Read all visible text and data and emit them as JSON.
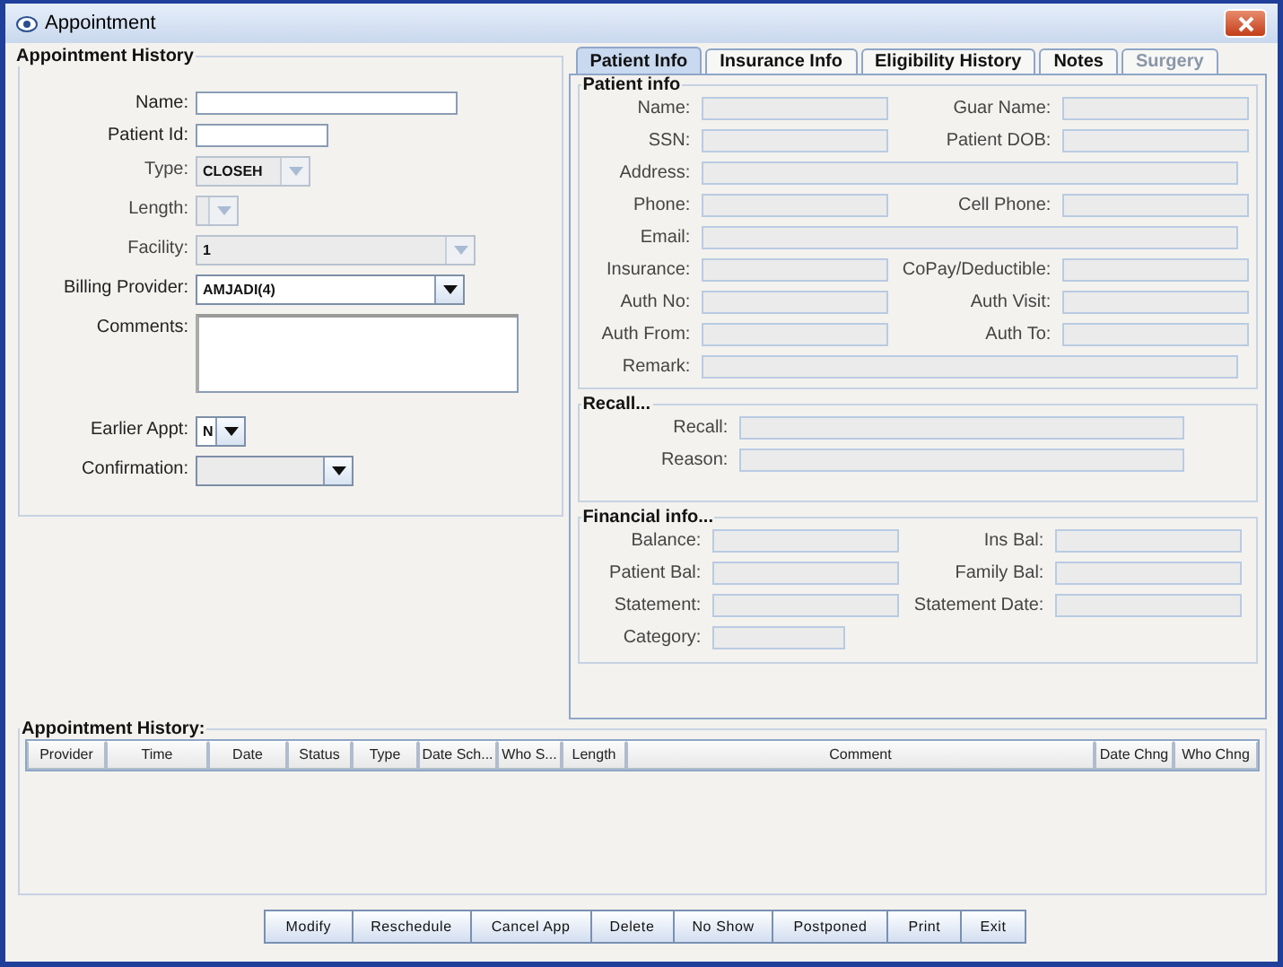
{
  "window": {
    "title": "Appointment"
  },
  "appointment_form": {
    "title": "Appointment History",
    "fields": [
      {
        "kind": "text",
        "label": "Name:"
      },
      {
        "kind": "text",
        "label": "Patient Id:"
      },
      {
        "kind": "combo",
        "label": "Type:",
        "value": "CLOSEH",
        "disabled": true
      },
      {
        "kind": "combo",
        "label": "Length:",
        "disabled": true
      },
      {
        "kind": "combo",
        "label": "Facility:",
        "value": "1",
        "disabled": true
      },
      {
        "kind": "combo",
        "label": "Billing Provider:",
        "value": "AMJADI(4)",
        "disabled": false
      },
      {
        "kind": "textarea",
        "label": "Comments:"
      },
      {
        "kind": "combo",
        "label": "Earlier Appt:",
        "value": "N",
        "disabled": false
      },
      {
        "kind": "combo",
        "label": "Confirmation:",
        "disabled": false
      }
    ]
  },
  "tabs": [
    {
      "label": "Patient Info",
      "selected": true,
      "disabled": false
    },
    {
      "label": "Insurance Info",
      "selected": false,
      "disabled": false
    },
    {
      "label": "Eligibility History",
      "selected": false,
      "disabled": false
    },
    {
      "label": "Notes",
      "selected": false,
      "disabled": false
    },
    {
      "label": "Surgery",
      "selected": false,
      "disabled": true
    }
  ],
  "sections": [
    {
      "title": "Patient info",
      "rows": [
        [
          "Name:",
          "Guar Name:"
        ],
        [
          "SSN:",
          "Patient DOB:"
        ],
        [
          "Address:"
        ],
        [
          "Phone:",
          "Cell Phone:"
        ],
        [
          "Email:"
        ],
        [
          "Insurance:",
          "CoPay/Deductible:"
        ],
        [
          "Auth No:",
          "Auth Visit:"
        ],
        [
          "Auth From:",
          "Auth To:"
        ],
        [
          "Remark:"
        ]
      ]
    },
    {
      "title": "Recall...",
      "rows": [
        [
          "Recall:"
        ],
        [
          "Reason:"
        ]
      ]
    },
    {
      "title": "Financial info...",
      "rows": [
        [
          "Balance:",
          "Ins Bal:"
        ],
        [
          "Patient Bal:",
          "Family Bal:"
        ],
        [
          "Statement:",
          "Statement Date:"
        ],
        [
          "Category:",
          null
        ]
      ]
    }
  ],
  "history": {
    "title": "Appointment History:",
    "columns": [
      "Provider",
      "Time",
      "Date",
      "Status",
      "Type",
      "Date Sch...",
      "Who S...",
      "Length",
      "Comment",
      "Date Chng",
      "Who Chng"
    ]
  },
  "buttons": [
    {
      "label": "Modify"
    },
    {
      "label": "Reschedule"
    },
    {
      "label": "Cancel App"
    },
    {
      "label": "Delete"
    },
    {
      "label": "No Show"
    },
    {
      "label": "Postponed"
    },
    {
      "label": "Print"
    },
    {
      "label": "Exit"
    }
  ]
}
